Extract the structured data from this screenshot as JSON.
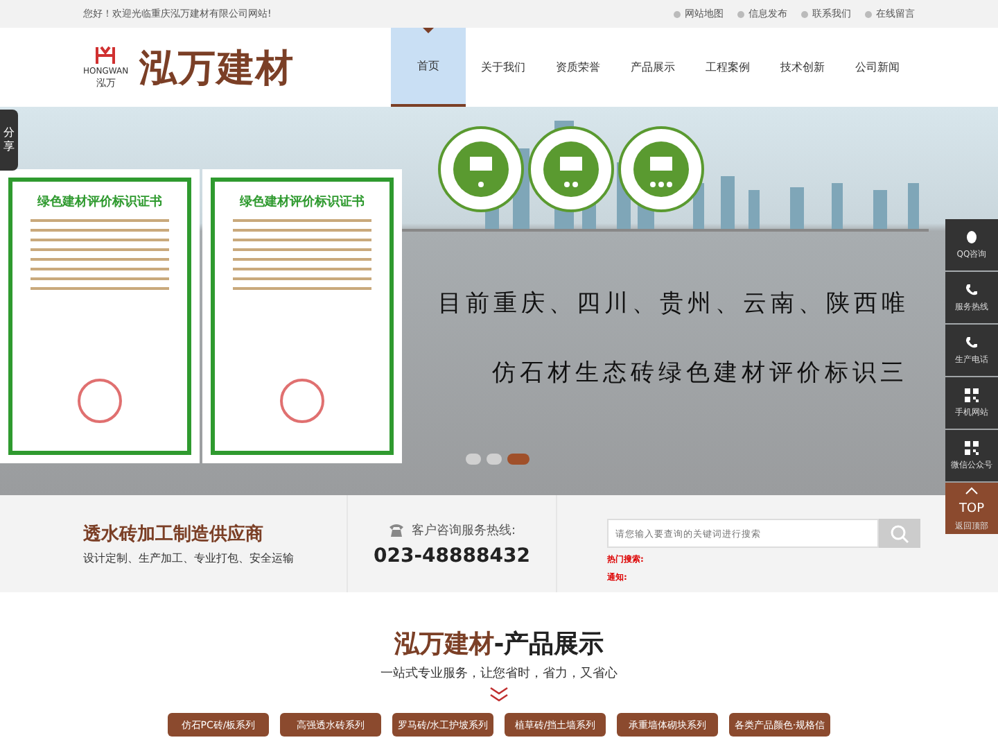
{
  "topbar": {
    "welcome": "您好！欢迎光临重庆泓万建材有限公司网站!",
    "links": [
      "网站地图",
      "信息发布",
      "联系我们",
      "在线留言"
    ]
  },
  "header": {
    "logo_mark": "HONGWAN",
    "logo_sub": "泓万",
    "brand": "泓万建材",
    "nav": [
      {
        "label": "首页",
        "selected": true
      },
      {
        "label": "关于我们",
        "selected": false
      },
      {
        "label": "资质荣誉",
        "selected": false
      },
      {
        "label": "产品展示",
        "selected": false
      },
      {
        "label": "工程案例",
        "selected": false
      },
      {
        "label": "技术创新",
        "selected": false
      },
      {
        "label": "公司新闻",
        "selected": false
      }
    ]
  },
  "share": "分享",
  "banner": {
    "certificates": [
      "绿色建材评价标识证书",
      "绿色建材评价标识证书"
    ],
    "caption_1": "目前重庆、四川、贵州、云南、陕西唯",
    "caption_2": "仿石材生态砖绿色建材评价标识三",
    "dots": [
      {
        "selected": false
      },
      {
        "selected": false
      },
      {
        "selected": true
      }
    ]
  },
  "side_bar": [
    {
      "kind": "qq",
      "label": "QQ咨询"
    },
    {
      "kind": "phone",
      "label": "服务热线"
    },
    {
      "kind": "phone",
      "label": "生产电话"
    },
    {
      "kind": "qr",
      "label": "手机网站"
    },
    {
      "kind": "qr",
      "label": "微信公众号"
    },
    {
      "kind": "top",
      "title": "TOP",
      "label": "返回顶部"
    }
  ],
  "info": {
    "title": "透水砖加工制造供应商",
    "subtitle": "设计定制、生产加工、专业打包、安全运输",
    "hotline_label": "客户咨询服务热线:",
    "hotline": "023-48888432",
    "search": {
      "placeholder": "请您输入要查询的关键词进行搜索"
    },
    "hot_label": "热门搜索:",
    "notice_label": "通知:"
  },
  "products": {
    "title_brand": "泓万建材",
    "title_rest": "-产品展示",
    "subtitle": "一站式专业服务，让您省时，省力，又省心",
    "categories": [
      "仿石PC砖/板系列",
      "高强透水砖系列",
      "罗马砖/水工护坡系列",
      "植草砖/挡土墙系列",
      "承重墙体砌块系列",
      "各类产品颜色·规格信"
    ]
  }
}
